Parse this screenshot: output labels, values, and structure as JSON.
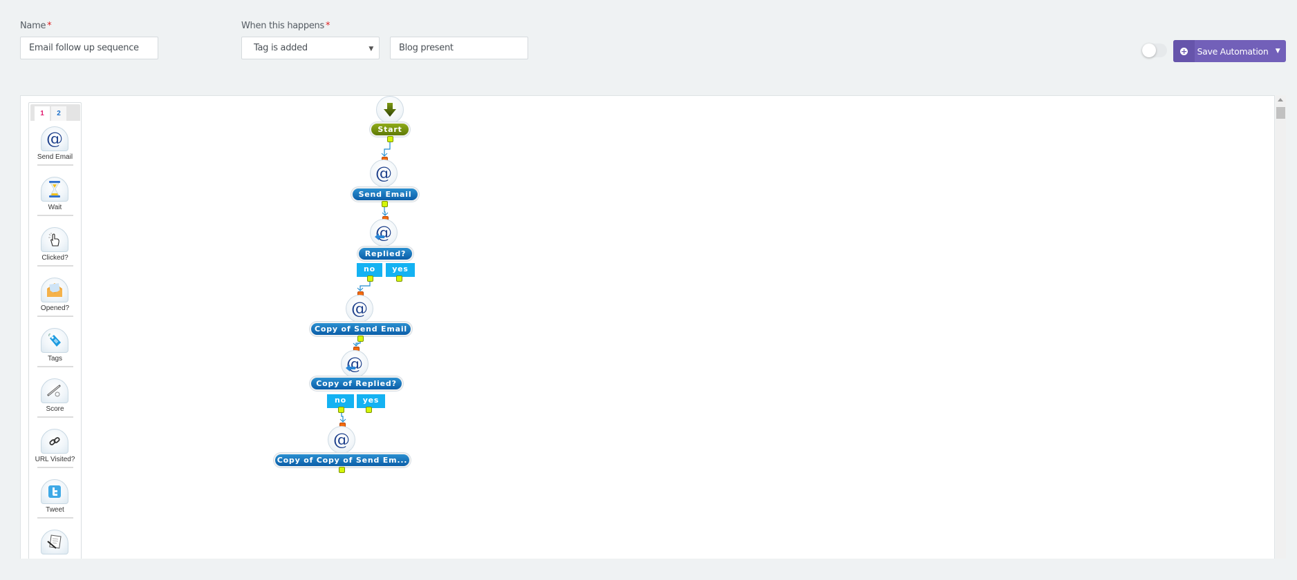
{
  "form": {
    "name_label": "Name",
    "name_required": "*",
    "name_value": "Email follow up sequence",
    "trigger_label": "When this happens",
    "trigger_required": "*",
    "trigger_selected": "Tag is added",
    "trigger_value": "Blog present"
  },
  "toolbar": {
    "toggle_on": false,
    "save_label": "Save Automation",
    "save_icon": "plus-circle-icon",
    "dropdown_icon": "caret-down-icon"
  },
  "palette": {
    "tabs": [
      "1",
      "2"
    ],
    "active_tab": "1",
    "items": [
      {
        "label": "Send Email",
        "icon": "at-sign-icon"
      },
      {
        "label": "Wait",
        "icon": "hourglass-icon"
      },
      {
        "label": "Clicked?",
        "icon": "hand-pointer-icon"
      },
      {
        "label": "Opened?",
        "icon": "open-envelope-icon"
      },
      {
        "label": "Tags",
        "icon": "tag-icon"
      },
      {
        "label": "Score",
        "icon": "pen-score-icon"
      },
      {
        "label": "URL Visited?",
        "icon": "link-icon"
      },
      {
        "label": "Tweet",
        "icon": "twitter-icon"
      },
      {
        "label": "",
        "icon": "note-pen-icon"
      }
    ]
  },
  "flow": {
    "nodes": [
      {
        "id": "start",
        "label": "Start",
        "icon": "down-arrow-icon",
        "type": "start"
      },
      {
        "id": "send1",
        "label": "Send Email",
        "icon": "at-sign-icon",
        "type": "action"
      },
      {
        "id": "replied1",
        "label": "Replied?",
        "icon": "at-reply-icon",
        "type": "decision",
        "branches": [
          "no",
          "yes"
        ]
      },
      {
        "id": "send2",
        "label": "Copy of Send Email",
        "icon": "at-sign-icon",
        "type": "action"
      },
      {
        "id": "replied2",
        "label": "Copy of Replied?",
        "icon": "at-reply-icon",
        "type": "decision",
        "branches": [
          "no",
          "yes"
        ]
      },
      {
        "id": "send3",
        "label": "Copy of Copy of Send Em...",
        "icon": "at-sign-icon",
        "type": "action"
      }
    ]
  },
  "colors": {
    "accent": "#7260b9",
    "start_node": "#7a9510",
    "action_node": "#1b72bb",
    "branch": "#14b2f2",
    "port_out": "#d4f50a",
    "port_in": "#f46b0e",
    "required": "#e02020"
  }
}
